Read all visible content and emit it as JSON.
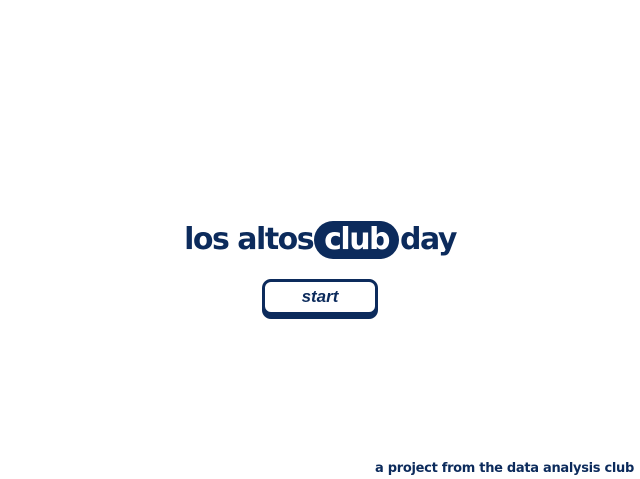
{
  "title": {
    "part1": "los altos",
    "highlight": "club",
    "part2": "day"
  },
  "start_button": {
    "label": "start"
  },
  "footer": {
    "text": "a project from the data analysis club"
  },
  "colors": {
    "brand": "#0c2b5c",
    "background": "#ffffff"
  }
}
